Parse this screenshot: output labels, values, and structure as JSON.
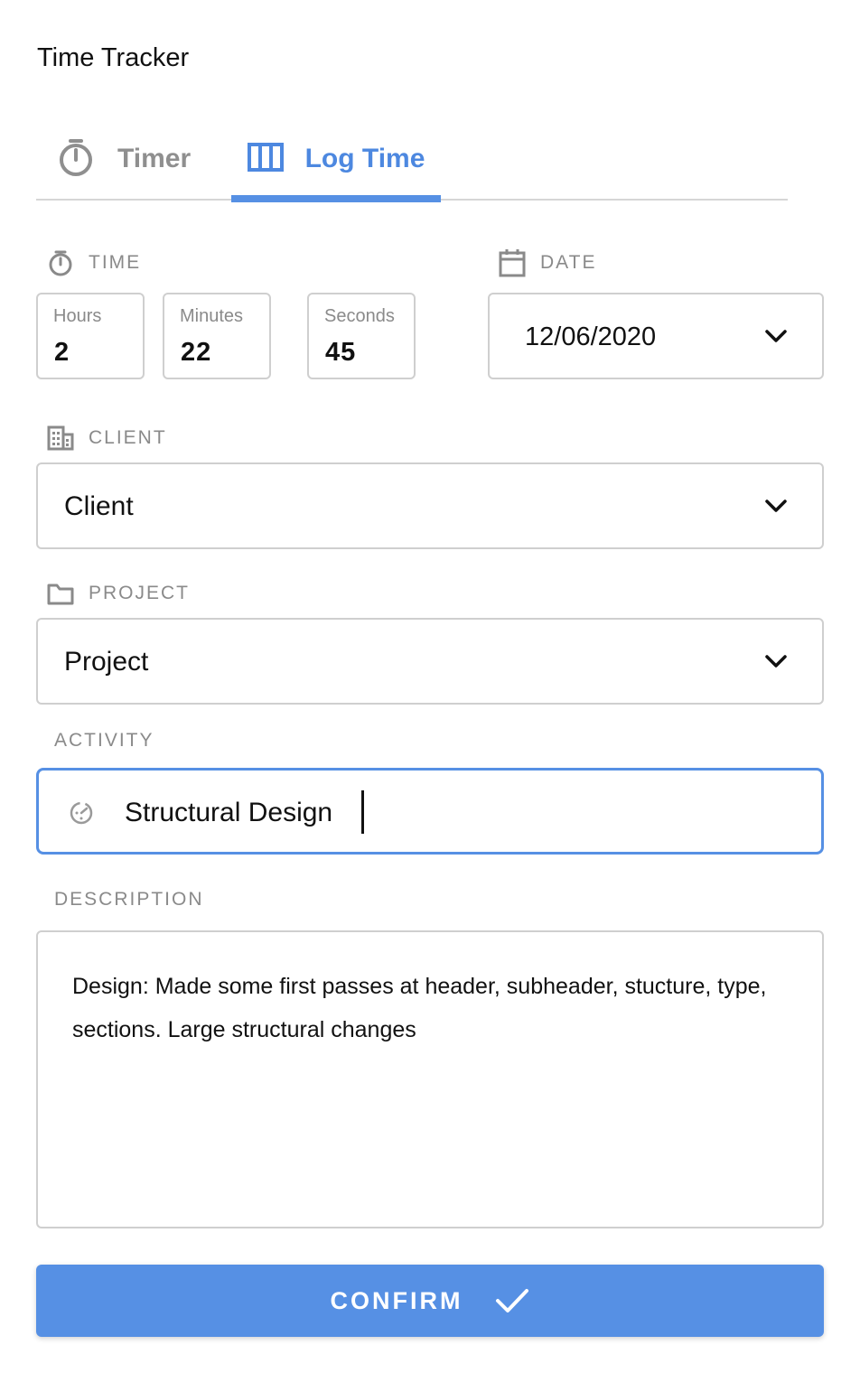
{
  "app": {
    "title": "Time Tracker"
  },
  "tabs": [
    {
      "label": "Timer",
      "icon": "stopwatch-icon",
      "active": false
    },
    {
      "label": "Log Time",
      "icon": "columns-icon",
      "active": true
    }
  ],
  "time": {
    "label": "TIME",
    "icon": "stopwatch-icon",
    "fields": [
      {
        "label": "Hours",
        "value": "2"
      },
      {
        "label": "Minutes",
        "value": "22"
      },
      {
        "label": "Seconds",
        "value": "45"
      }
    ]
  },
  "date": {
    "label": "DATE",
    "icon": "calendar-icon",
    "value": "12/06/2020"
  },
  "client": {
    "label": "CLIENT",
    "icon": "building-icon",
    "value": "Client"
  },
  "project": {
    "label": "PROJECT",
    "icon": "folder-icon",
    "value": "Project"
  },
  "activity": {
    "label": "ACTIVITY",
    "icon": "activity-dial-icon",
    "value": "Structural Design"
  },
  "description": {
    "label": "DESCRIPTION",
    "value": "Design: Made some first passes at header, subheader, stucture, type, sections. Large structural changes"
  },
  "confirm": {
    "label": "CONFIRM",
    "icon": "checkmark-icon"
  },
  "colors": {
    "accent": "#5690e4",
    "muted_text": "#8a8a8a",
    "border": "#cfcfcf"
  }
}
